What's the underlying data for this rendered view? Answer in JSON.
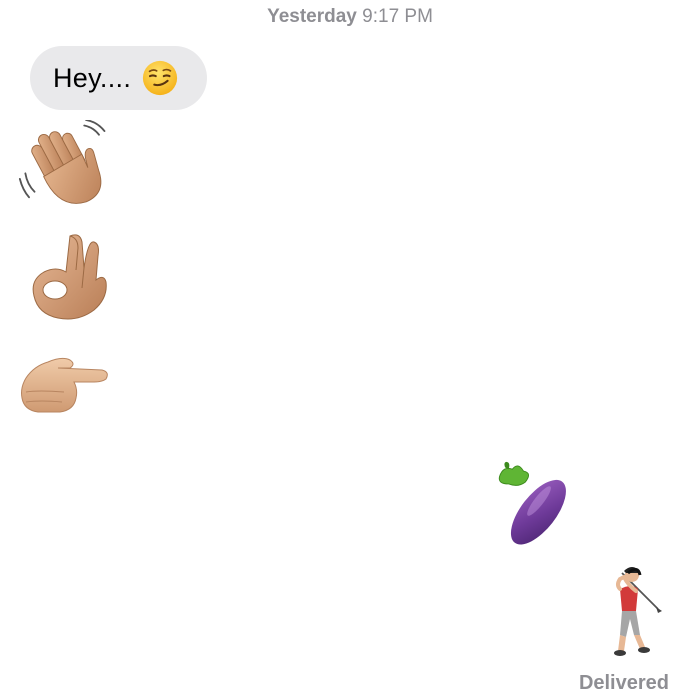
{
  "header": {
    "timestamp_day": "Yesterday",
    "timestamp_time": "9:17 PM"
  },
  "messages": {
    "incoming": [
      {
        "text": "Hey....",
        "emoji": "smirking-face"
      },
      {
        "emoji": "waving-hand"
      },
      {
        "emoji": "ok-hand"
      },
      {
        "emoji": "pointing-right-hand"
      }
    ],
    "outgoing": [
      {
        "emoji": "eggplant"
      },
      {
        "emoji": "golfer"
      }
    ]
  },
  "status": {
    "delivered_label": "Delivered"
  },
  "colors": {
    "incoming_bubble": "#e9e9eb",
    "timestamp_text": "#8e8e93",
    "skin_tone": "#d9a47e"
  }
}
